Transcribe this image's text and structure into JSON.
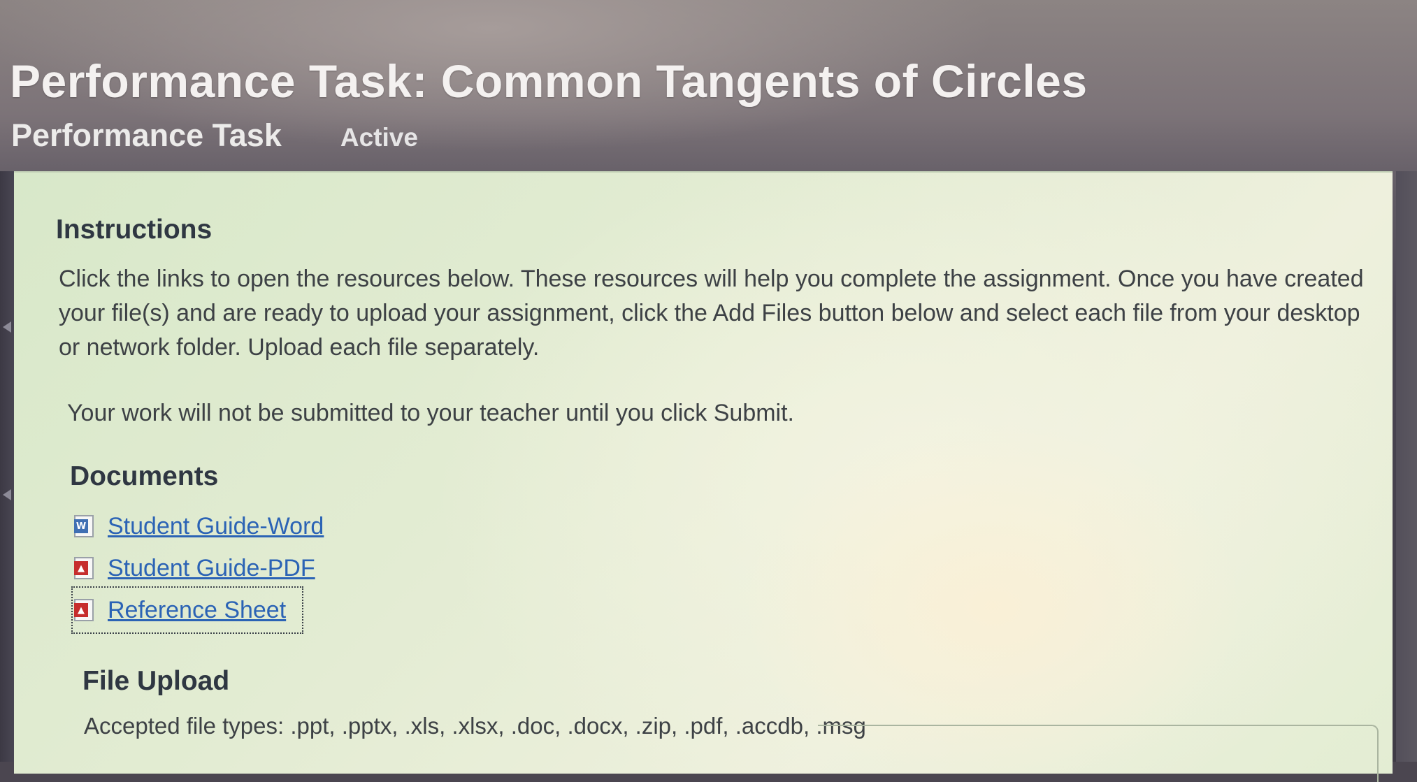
{
  "header": {
    "title": "Performance Task: Common Tangents of Circles",
    "task_type": "Performance Task",
    "status": "Active"
  },
  "instructions": {
    "heading": "Instructions",
    "body": "Click the links to open the resources below. These resources will help you complete the assignment. Once you have created your file(s) and are ready to upload your assignment, click the Add Files button below and select each file from your desktop or network folder. Upload each file separately.",
    "submit_note": "Your work will not be submitted to your teacher until you click Submit."
  },
  "documents": {
    "heading": "Documents",
    "items": [
      {
        "label": "Student Guide-Word",
        "icon": "word-doc-icon"
      },
      {
        "label": "Student Guide-PDF",
        "icon": "pdf-icon"
      },
      {
        "label": "Reference Sheet",
        "icon": "pdf-icon"
      }
    ]
  },
  "file_upload": {
    "heading": "File Upload",
    "accepted_types": "Accepted file types: .ppt, .pptx, .xls, .xlsx, .doc, .docx, .zip, .pdf, .accdb, .msg"
  },
  "colors": {
    "link": "#2b63b5",
    "panel_background": "#e3ecd3",
    "header_background": "#5f5963",
    "heading_text": "#2f3742"
  }
}
